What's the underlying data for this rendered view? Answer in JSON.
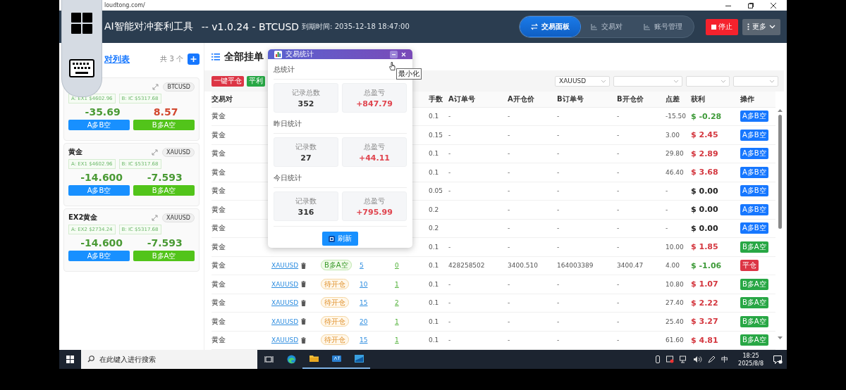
{
  "browser": {
    "url": "loudtong.com/"
  },
  "floating_toolbar": {
    "buttons": [
      {
        "kind": "windows"
      },
      {
        "kind": "keyboard"
      }
    ]
  },
  "app_header": {
    "title": "AI智能对冲套利工具",
    "version": "-- v1.0.24 - BTCUSD",
    "expiry": "到期时间: 2035-12-18 18:47:00",
    "nav_tabs": [
      {
        "label": "交易面板",
        "kind": "swap",
        "selected": true
      },
      {
        "label": "交易对",
        "kind": "chart",
        "selected": false
      },
      {
        "label": "账号管理",
        "kind": "chart",
        "selected": false
      }
    ],
    "stop_button": "停止",
    "more_button": "更多"
  },
  "sidebar": {
    "title": "对列表",
    "count": "共 3 个",
    "cards": [
      {
        "symbol": "BTCUSD",
        "price_a": "A: EX1 $4602.96",
        "price_b": "B: IC $5317.68",
        "value_a": {
          "text": "-35.69",
          "color": "#4a9a35"
        },
        "value_b": {
          "text": "8.57",
          "color": "#d2482f"
        },
        "buttons": [
          {
            "label": "A多B空",
            "kind": "a_long"
          },
          {
            "label": "B多A空",
            "kind": "b_long"
          }
        ]
      },
      {
        "title": "黄金",
        "symbol": "XAUUSD",
        "price_a": "A: EX1 $4602.96",
        "price_b": "B: IC $5317.68",
        "value_a": {
          "text": "-14.600",
          "color": "#4a9a35"
        },
        "value_b": {
          "text": "-7.593",
          "color": "#4a9a35"
        },
        "buttons": [
          {
            "label": "A多B空",
            "kind": "a_long"
          },
          {
            "label": "B多A空",
            "kind": "b_long"
          }
        ]
      },
      {
        "title": "EX2黄金",
        "symbol": "XAUUSD",
        "price_a": "A: EX2 $2734.24",
        "price_b": "B: IC $5317.68",
        "value_a": {
          "text": "-14.600",
          "color": "#4a9a35"
        },
        "value_b": {
          "text": "-7.593",
          "color": "#4a9a35"
        },
        "buttons": [
          {
            "label": "A多B空",
            "kind": "a_long"
          },
          {
            "label": "B多A空",
            "kind": "b_long"
          }
        ]
      }
    ]
  },
  "main": {
    "title": "全部挂单",
    "actions": [
      {
        "label": "一键平仓",
        "kind": "danger"
      },
      {
        "label": "平利",
        "kind": "success"
      }
    ],
    "filters": [
      {
        "kind": "select",
        "value": "XAUUSD"
      },
      {
        "kind": "select"
      },
      {
        "kind": "select"
      },
      {
        "kind": "select"
      }
    ],
    "table": {
      "columns": [
        {
          "label": "交易对"
        },
        {},
        {},
        {},
        {},
        {
          "label": "手数"
        },
        {
          "label": "A订单号"
        },
        {
          "label": "A开仓价"
        },
        {
          "label": "B订单号"
        },
        {
          "label": "B开仓价"
        },
        {
          "label": "点差"
        },
        {
          "label": "获利"
        },
        {
          "label": "操作"
        }
      ],
      "rows": [
        {
          "pair": "黄金",
          "lots": "0.1",
          "a_order": "-",
          "a_price": "-",
          "b_order": "-",
          "b_price": "-",
          "spread": "-15.50",
          "profit": {
            "text": "$ -0.28",
            "color": "#3f9b3a"
          },
          "action": {
            "label": "A多B空",
            "kind": "a_long"
          }
        },
        {
          "pair": "黄金",
          "lots": "0.15",
          "a_order": "-",
          "a_price": "-",
          "b_order": "-",
          "b_price": "-",
          "spread": "3.00",
          "profit": {
            "text": "$ 2.45",
            "color": "#d4373f"
          },
          "action": {
            "label": "A多B空",
            "kind": "a_long"
          }
        },
        {
          "pair": "黄金",
          "lots": "0.1",
          "a_order": "-",
          "a_price": "-",
          "b_order": "-",
          "b_price": "-",
          "spread": "29.80",
          "profit": {
            "text": "$ 2.89",
            "color": "#d4373f"
          },
          "action": {
            "label": "A多B空",
            "kind": "a_long"
          }
        },
        {
          "pair": "黄金",
          "lots": "0.1",
          "a_order": "-",
          "a_price": "-",
          "b_order": "-",
          "b_price": "-",
          "spread": "46.40",
          "profit": {
            "text": "$ 3.68",
            "color": "#d4373f"
          },
          "action": {
            "label": "A多B空",
            "kind": "a_long"
          }
        },
        {
          "pair": "黄金",
          "lots": "0.05",
          "a_order": "-",
          "a_price": "-",
          "b_order": "-",
          "b_price": "-",
          "spread": "-",
          "profit": {
            "text": "$ 0.00",
            "color": "#222222"
          },
          "action": {
            "label": "A多B空",
            "kind": "a_long"
          }
        },
        {
          "pair": "黄金",
          "lots": "0.2",
          "a_price": "-",
          "b_order": "-",
          "b_price": "-",
          "spread": "-",
          "profit": {
            "text": "$ 0.00",
            "color": "#222222"
          },
          "action": {
            "label": "A多B空",
            "kind": "a_long"
          }
        },
        {
          "pair": "黄金",
          "lots": "0.2",
          "a_price": "-",
          "b_order": "-",
          "b_price": "-",
          "spread": "-",
          "profit": {
            "text": "$ 0.00",
            "color": "#222222"
          },
          "action": {
            "label": "A多B空",
            "kind": "a_long"
          }
        },
        {
          "pair": "黄金",
          "lots": "0.1",
          "a_order": "-",
          "a_price": "-",
          "b_order": "-",
          "b_price": "-",
          "spread": "10.00",
          "profit": {
            "text": "$ 1.85",
            "color": "#d4373f"
          },
          "action": {
            "label": "B多A空",
            "kind": "b_long"
          }
        },
        {
          "pair": "黄金",
          "symbol": "XAUUSD",
          "status": {
            "label": "B多A空",
            "kind": "b_long"
          },
          "col_4": "5",
          "col_5": "0",
          "lots": "0.1",
          "a_order": "428258502",
          "a_price": "3400.510",
          "b_order": "164003389",
          "b_price": "3400.47",
          "spread": "4.00",
          "profit": {
            "text": "$ -1.06",
            "color": "#3f9b3a"
          },
          "action": {
            "label": "平仓",
            "kind": "close"
          }
        },
        {
          "pair": "黄金",
          "symbol": "XAUUSD",
          "status": {
            "label": "待开仓",
            "kind": "pending"
          },
          "col_4": "10",
          "col_5": "1",
          "lots": "0.1",
          "a_order": "-",
          "a_price": "-",
          "b_order": "-",
          "b_price": "-",
          "spread": "10.80",
          "profit": {
            "text": "$ 1.07",
            "color": "#d4373f"
          },
          "action": {
            "label": "B多A空",
            "kind": "b_long"
          }
        },
        {
          "pair": "黄金",
          "symbol": "XAUUSD",
          "status": {
            "label": "待开仓",
            "kind": "pending"
          },
          "col_4": "15",
          "col_5": "2",
          "lots": "0.1",
          "a_order": "-",
          "a_price": "-",
          "b_order": "-",
          "b_price": "-",
          "spread": "27.40",
          "profit": {
            "text": "$ 2.22",
            "color": "#d4373f"
          },
          "action": {
            "label": "B多A空",
            "kind": "b_long"
          }
        },
        {
          "pair": "黄金",
          "symbol": "XAUUSD",
          "status": {
            "label": "待开仓",
            "kind": "pending"
          },
          "col_4": "20",
          "col_5": "1",
          "lots": "0.1",
          "a_order": "-",
          "a_price": "-",
          "b_order": "-",
          "b_price": "-",
          "spread": "25.40",
          "profit": {
            "text": "$ 3.27",
            "color": "#d4373f"
          },
          "action": {
            "label": "B多A空",
            "kind": "b_long"
          }
        },
        {
          "pair": "黄金",
          "symbol": "XAUUSD",
          "status": {
            "label": "待开仓",
            "kind": "pending"
          },
          "col_4": "15",
          "col_5": "1",
          "lots": "0.1",
          "a_order": "-",
          "a_price": "-",
          "b_order": "-",
          "b_price": "-",
          "spread": "61.60",
          "profit": {
            "text": "$ 4.81",
            "color": "#d4373f"
          },
          "action": {
            "label": "B多A空",
            "kind": "b_long"
          }
        }
      ]
    }
  },
  "stats_popup": {
    "title": "交易统计",
    "tooltip": "最小化",
    "sections": [
      {
        "title": "总统计",
        "count_label": "记录总数",
        "count": "352",
        "total_label": "总盈亏",
        "total": "+847.79"
      },
      {
        "title": "昨日统计",
        "count_label": "记录数",
        "count": "27",
        "total_label": "总盈亏",
        "total": "+44.11"
      },
      {
        "title": "今日统计",
        "count_label": "记录数",
        "count": "316",
        "total_label": "总盈亏",
        "total": "+795.99"
      }
    ],
    "refresh_button": "刷新"
  },
  "taskbar": {
    "search_placeholder": "在此键入进行搜索",
    "apps": [
      {
        "kind": "task_view",
        "running": false
      },
      {
        "kind": "edge",
        "running": false
      },
      {
        "kind": "folder",
        "running": true
      },
      {
        "kind": "app",
        "running": true
      },
      {
        "kind": "window",
        "running": true
      }
    ],
    "ime": "中",
    "time": "18:25",
    "date": "2025/8/8"
  }
}
